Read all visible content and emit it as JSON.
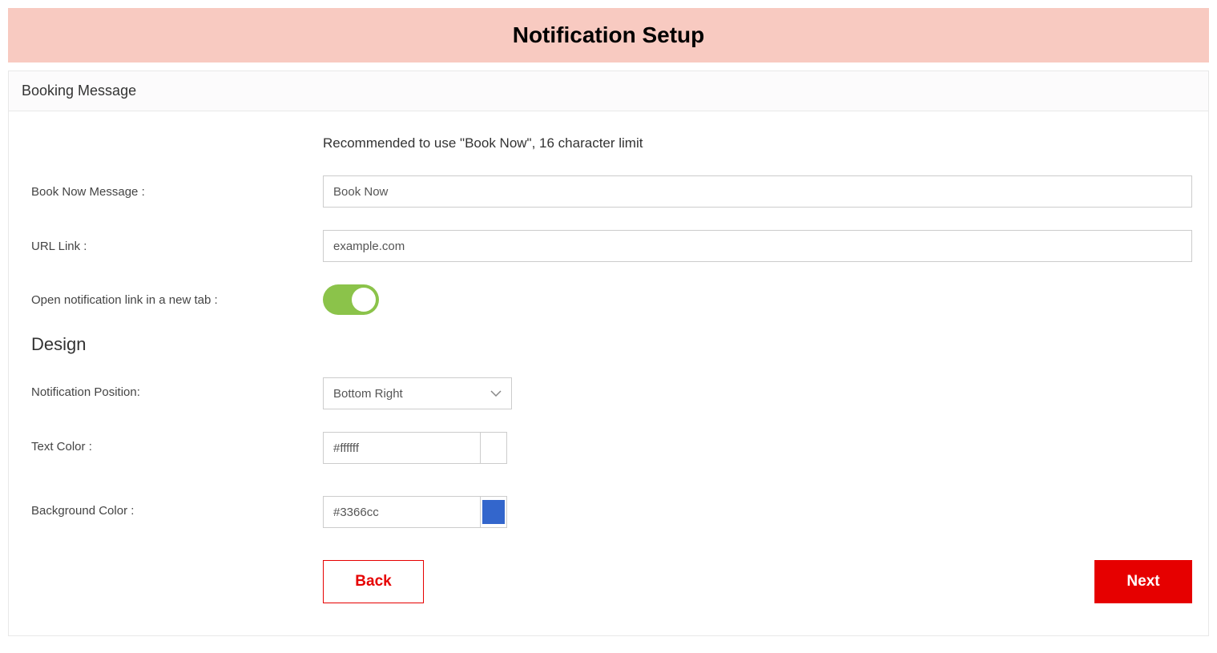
{
  "header": {
    "title": "Notification Setup"
  },
  "card": {
    "title": "Booking Message",
    "hint": "Recommended to use \"Book Now\", 16 character limit"
  },
  "form": {
    "book_now_label": "Book Now Message :",
    "book_now_value": "Book Now",
    "url_label": "URL Link :",
    "url_value": "example.com",
    "open_new_tab_label": "Open notification link in a new tab :",
    "design_title": "Design",
    "position_label": "Notification Position:",
    "position_value": "Bottom Right",
    "text_color_label": "Text Color :",
    "text_color_value": "#ffffff",
    "bg_color_label": "Background Color :",
    "bg_color_value": "#3366cc"
  },
  "colors": {
    "text_color_swatch": "#ffffff",
    "bg_color_swatch": "#3366cc"
  },
  "buttons": {
    "back_label": "Back",
    "next_label": "Next"
  }
}
